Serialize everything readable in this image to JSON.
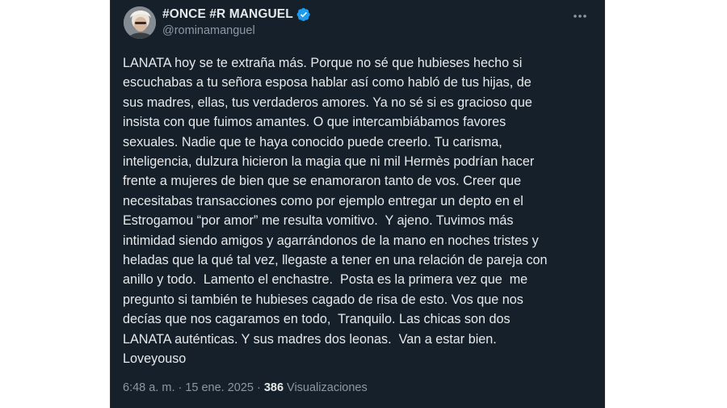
{
  "user": {
    "display_name": "#ONCE #R MANGUEL",
    "handle": "@rominamanguel",
    "verified": true,
    "avatar_icon": "profile-photo"
  },
  "tweet": {
    "text": "LANATA hoy se te extraña más. Porque no sé que hubieses hecho si\nescuchabas a tu señora esposa hablar así como habló de tus hijas, de\nsus madres, ellas, tus verdaderos amores. Ya no sé si es gracioso que\ninsista con que fuimos amantes. O que intercambiábamos favores\nsexuales. Nadie que te haya conocido puede creerlo. Tu carisma,\ninteligencia, dulzura hicieron la magia que ni mil Hermès podrían hacer\nfrente a mujeres de bien que se enamoraron tanto de vos. Creer que\nnecesitabas transacciones como por ejemplo entregar un depto en el\nEstrogamou “por amor” me resulta vomitivo.  Y ajeno. Tuvimos más\nintimidad siendo amigos y agarrándonos de la mano en noches tristes y\nheladas que la qué tal vez, llegaste a tener en una relación de pareja con\nanillo y todo.  Lamento el enchastre.  Posta es la primera vez que  me\npregunto si también te hubieses cagado de risa de esto. Vos que nos\ndecías que nos cagaramos en todo,  Tranquilo. Las chicas son dos\nLANATA auténticas. Y sus madres dos leonas.  Van a estar bien.\nLoveyouso",
    "time": "6:48 a. m.",
    "separator": "·",
    "date": "15 ene. 2025",
    "views_count": "386",
    "views_label": "Visualizaciones"
  },
  "colors": {
    "background": "#15202b",
    "text": "#e7e9ea",
    "secondary": "#8b98a5",
    "verified_badge": "#1d9bf0"
  },
  "icons": {
    "verified": "verified-badge-icon",
    "more": "more-options-icon"
  }
}
